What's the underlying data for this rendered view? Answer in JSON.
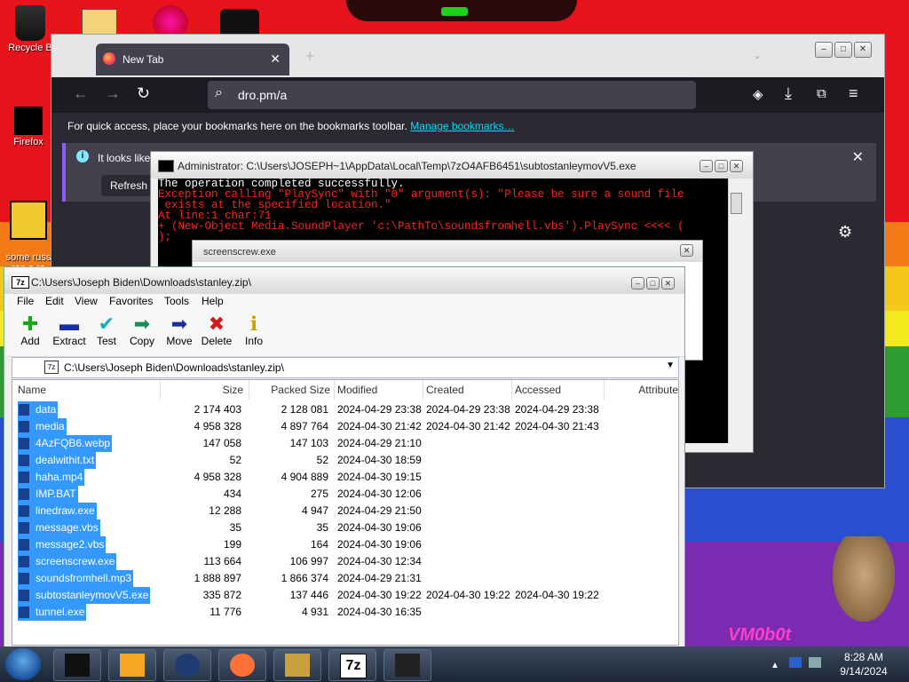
{
  "desktop": {
    "icons": [
      {
        "label": "Recycle B"
      },
      {
        "label": "Firefox"
      },
      {
        "label": "some russ\nran a ra"
      }
    ],
    "watermark": "VM0b0t"
  },
  "firefox": {
    "tab_title": "New Tab",
    "url": "dro.pm/a",
    "bookmarks_text": "For quick access, place your bookmarks here on the bookmarks toolbar.",
    "bookmarks_link": "Manage bookmarks…",
    "notice_text": "It looks like",
    "notice_button": "Refresh F"
  },
  "cmd": {
    "title": "Administrator: C:\\Users\\JOSEPH~1\\AppData\\Local\\Temp\\7zO4AFB6451\\subtostanleymovV5.exe",
    "lines": [
      "The operation completed successfully.",
      "Exception calling \"PlaySync\" with \"0\" argument(s): \"Please be sure a sound file",
      " exists at the specified location.\"",
      "At line:1 char:71",
      "+ (New-Object Media.SoundPlayer 'c:\\PathTo\\soundsfromhell.vbs').PlaySync <<<< (",
      ");"
    ]
  },
  "screenscrew": {
    "title": "screenscrew.exe"
  },
  "sevenzip": {
    "title": "C:\\Users\\Joseph Biden\\Downloads\\stanley.zip\\",
    "menu": [
      "File",
      "Edit",
      "View",
      "Favorites",
      "Tools",
      "Help"
    ],
    "toolbar": [
      {
        "label": "Add",
        "icon": "plus-icon",
        "glyph": "✚",
        "color": "#1aa51a"
      },
      {
        "label": "Extract",
        "icon": "minus-icon",
        "glyph": "▬",
        "color": "#1a2fa5"
      },
      {
        "label": "Test",
        "icon": "check-icon",
        "glyph": "✔",
        "color": "#17b0b0"
      },
      {
        "label": "Copy",
        "icon": "copy-arrow-icon",
        "glyph": "➡",
        "color": "#1a8a5a"
      },
      {
        "label": "Move",
        "icon": "move-arrow-icon",
        "glyph": "➡",
        "color": "#1a2f9a"
      },
      {
        "label": "Delete",
        "icon": "delete-x-icon",
        "glyph": "✖",
        "color": "#d21a1a"
      },
      {
        "label": "Info",
        "icon": "info-icon",
        "glyph": "ℹ",
        "color": "#c8a400"
      }
    ],
    "address": "C:\\Users\\Joseph Biden\\Downloads\\stanley.zip\\",
    "columns": [
      "Name",
      "Size",
      "Packed Size",
      "Modified",
      "Created",
      "Accessed",
      "Attribute"
    ],
    "rows": [
      {
        "name": "data",
        "size": "2 174 403",
        "packed": "2 128 081",
        "modified": "2024-04-29 23:38",
        "created": "2024-04-29 23:38",
        "accessed": "2024-04-29 23:38"
      },
      {
        "name": "media",
        "size": "4 958 328",
        "packed": "4 897 764",
        "modified": "2024-04-30 21:42",
        "created": "2024-04-30 21:42",
        "accessed": "2024-04-30 21:43"
      },
      {
        "name": "4AzFQB6.webp",
        "size": "147 058",
        "packed": "147 103",
        "modified": "2024-04-29 21:10",
        "created": "",
        "accessed": ""
      },
      {
        "name": "dealwithit.txt",
        "size": "52",
        "packed": "52",
        "modified": "2024-04-30 18:59",
        "created": "",
        "accessed": ""
      },
      {
        "name": "haha.mp4",
        "size": "4 958 328",
        "packed": "4 904 889",
        "modified": "2024-04-30 19:15",
        "created": "",
        "accessed": ""
      },
      {
        "name": "IMP.BAT",
        "size": "434",
        "packed": "275",
        "modified": "2024-04-30 12:06",
        "created": "",
        "accessed": ""
      },
      {
        "name": "linedraw.exe",
        "size": "12 288",
        "packed": "4 947",
        "modified": "2024-04-29 21:50",
        "created": "",
        "accessed": ""
      },
      {
        "name": "message.vbs",
        "size": "35",
        "packed": "35",
        "modified": "2024-04-30 19:06",
        "created": "",
        "accessed": ""
      },
      {
        "name": "message2.vbs",
        "size": "199",
        "packed": "164",
        "modified": "2024-04-30 19:06",
        "created": "",
        "accessed": ""
      },
      {
        "name": "screenscrew.exe",
        "size": "113 664",
        "packed": "106 997",
        "modified": "2024-04-30 12:34",
        "created": "",
        "accessed": ""
      },
      {
        "name": "soundsfromhell.mp3",
        "size": "1 888 897",
        "packed": "1 866 374",
        "modified": "2024-04-29 21:31",
        "created": "",
        "accessed": ""
      },
      {
        "name": "subtostanleymovV5.exe",
        "size": "335 872",
        "packed": "137 446",
        "modified": "2024-04-30 19:22",
        "created": "2024-04-30 19:22",
        "accessed": "2024-04-30 19:22"
      },
      {
        "name": "tunnel.exe",
        "size": "11 776",
        "packed": "4 931",
        "modified": "2024-04-30 16:35",
        "created": "",
        "accessed": ""
      }
    ]
  },
  "taskbar": {
    "time": "8:28 AM",
    "date": "9/14/2024",
    "items": [
      {
        "icon": "black-box-icon"
      },
      {
        "icon": "media-player-icon"
      },
      {
        "icon": "globe-icon"
      },
      {
        "icon": "firefox-icon"
      },
      {
        "icon": "bandicam-box-icon"
      },
      {
        "icon": "7zip-icon",
        "label": "7z"
      },
      {
        "icon": "face-icon"
      }
    ]
  }
}
